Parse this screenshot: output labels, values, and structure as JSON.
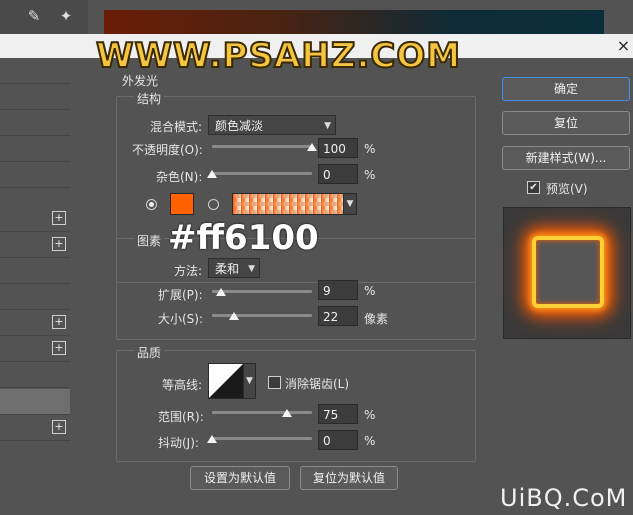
{
  "watermark": {
    "site": "WWW.PSAHZ.COM",
    "color_code": "#ff6100",
    "corner": "UiBQ.CoM"
  },
  "panel": {
    "partial_title": "外发光",
    "structure": {
      "title": "结构",
      "blend_mode_label": "混合模式:",
      "blend_mode_value": "颜色减淡",
      "opacity_label": "不透明度(O):",
      "opacity_value": "100",
      "opacity_unit": "%",
      "opacity_level": 100,
      "noise_label": "杂色(N):",
      "noise_value": "0",
      "noise_unit": "%",
      "noise_level": 0,
      "swatch_color": "#ff6100",
      "gradient_colors": [
        "#ff6100",
        "#ffffff"
      ]
    },
    "elements": {
      "title": "图素",
      "method_label": "方法:",
      "method_value": "柔和",
      "spread_label": "扩展(P):",
      "spread_value": "9",
      "spread_unit": "%",
      "spread_level": 9,
      "size_label": "大小(S):",
      "size_value": "22",
      "size_unit": "像素",
      "size_level": 22
    },
    "quality": {
      "title": "品质",
      "contour_label": "等高线:",
      "antialias_label": "消除锯齿(L)",
      "range_label": "范围(R):",
      "range_value": "75",
      "range_unit": "%",
      "range_level": 75,
      "jitter_label": "抖动(J):",
      "jitter_value": "0",
      "jitter_unit": "%",
      "jitter_level": 0
    },
    "set_default": "设置为默认值",
    "reset_default": "复位为默认值"
  },
  "right": {
    "ok": "确定",
    "reset": "复位",
    "new_style": "新建样式(W)...",
    "preview_label": "预览(V)",
    "preview_checked": true,
    "accent": "#3e8ee8"
  },
  "left_list": {
    "plus": "+"
  }
}
